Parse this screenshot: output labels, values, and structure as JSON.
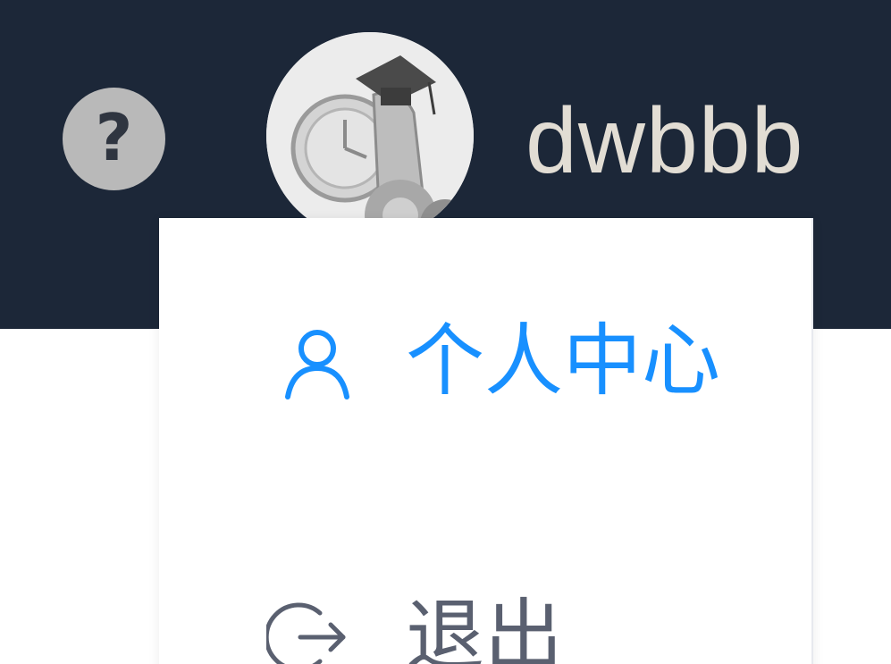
{
  "header": {
    "help_icon_glyph": "?",
    "username": "dwbbb",
    "background_color": "#1c2738"
  },
  "avatar": {
    "icon": "avatar-illustration"
  },
  "dropdown": {
    "items": [
      {
        "label": "个人中心",
        "icon": "user-icon",
        "color": "#1890ff",
        "active": true
      },
      {
        "label": "退出",
        "icon": "logout-icon",
        "color": "#5a6070",
        "active": false
      }
    ]
  }
}
